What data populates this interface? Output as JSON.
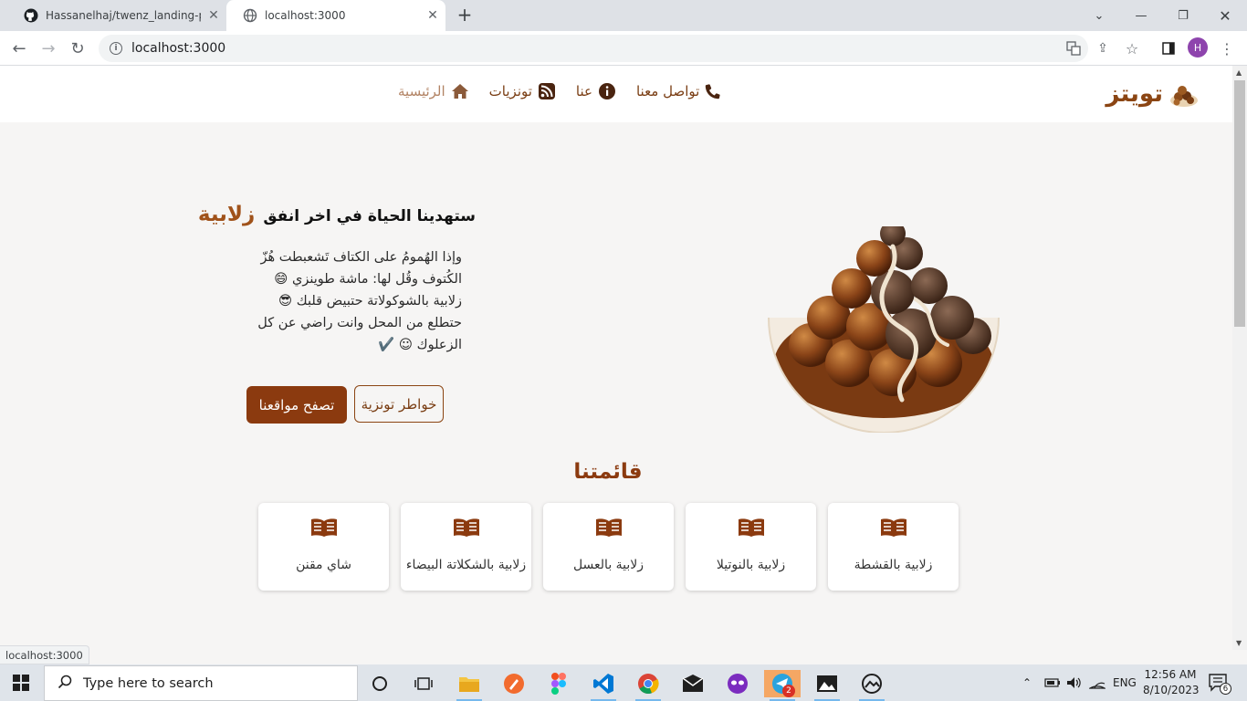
{
  "browser": {
    "tabs": [
      {
        "title": "Hassanelhaj/twenz_landing-page",
        "icon": "github-icon"
      },
      {
        "title": "localhost:3000",
        "icon": "globe-icon"
      }
    ],
    "url": "localhost:3000",
    "profile_initial": "H",
    "status_url": "localhost:3000"
  },
  "site": {
    "brand": "تويتز",
    "nav": [
      {
        "label": "الرئيسية",
        "icon": "home-icon"
      },
      {
        "label": "تونزيات",
        "icon": "rss-icon"
      },
      {
        "label": "عنا",
        "icon": "info-circle-icon"
      },
      {
        "label": "تواصل معنا",
        "icon": "phone-icon"
      }
    ],
    "hero": {
      "title": "ستهدينا الحياة في اخر انفق",
      "title_accent": "زلابية",
      "lines": [
        "وإذا الهُمومُ على الكتاف تَشعبطت هُزّ",
        "الكُتوف وقُل لها: ماشة طوينزي 😄",
        "زلابية بالشوكولاتة حتبيض قلبك 😎",
        "حتطلع من المحل وانت راضي عن كل",
        "الزعلوك ☺ ✔️"
      ],
      "button_outline": "خواطر تونزية",
      "button_solid": "تصفح مواقعنا"
    },
    "menu": {
      "title": "قائمتنا",
      "items": [
        {
          "label": "زلابية بالقشطة",
          "icon": "book-open-icon"
        },
        {
          "label": "زلابية بالنوتيلا",
          "icon": "book-open-icon"
        },
        {
          "label": "زلابية بالعسل",
          "icon": "book-open-icon"
        },
        {
          "label": "زلابية بالشكلاتة البيضاء",
          "icon": "book-open-icon"
        },
        {
          "label": "شاي مقنن",
          "icon": "book-open-icon"
        }
      ]
    }
  },
  "taskbar": {
    "search_placeholder": "Type here to search",
    "language": "ENG",
    "time": "12:56 AM",
    "date": "8/10/2023",
    "notification_count": "6",
    "telegram_badge": "2"
  },
  "colors": {
    "brand_brown": "#8b4513",
    "accent": "#a0521a",
    "button_fill": "#8b3a0f"
  }
}
